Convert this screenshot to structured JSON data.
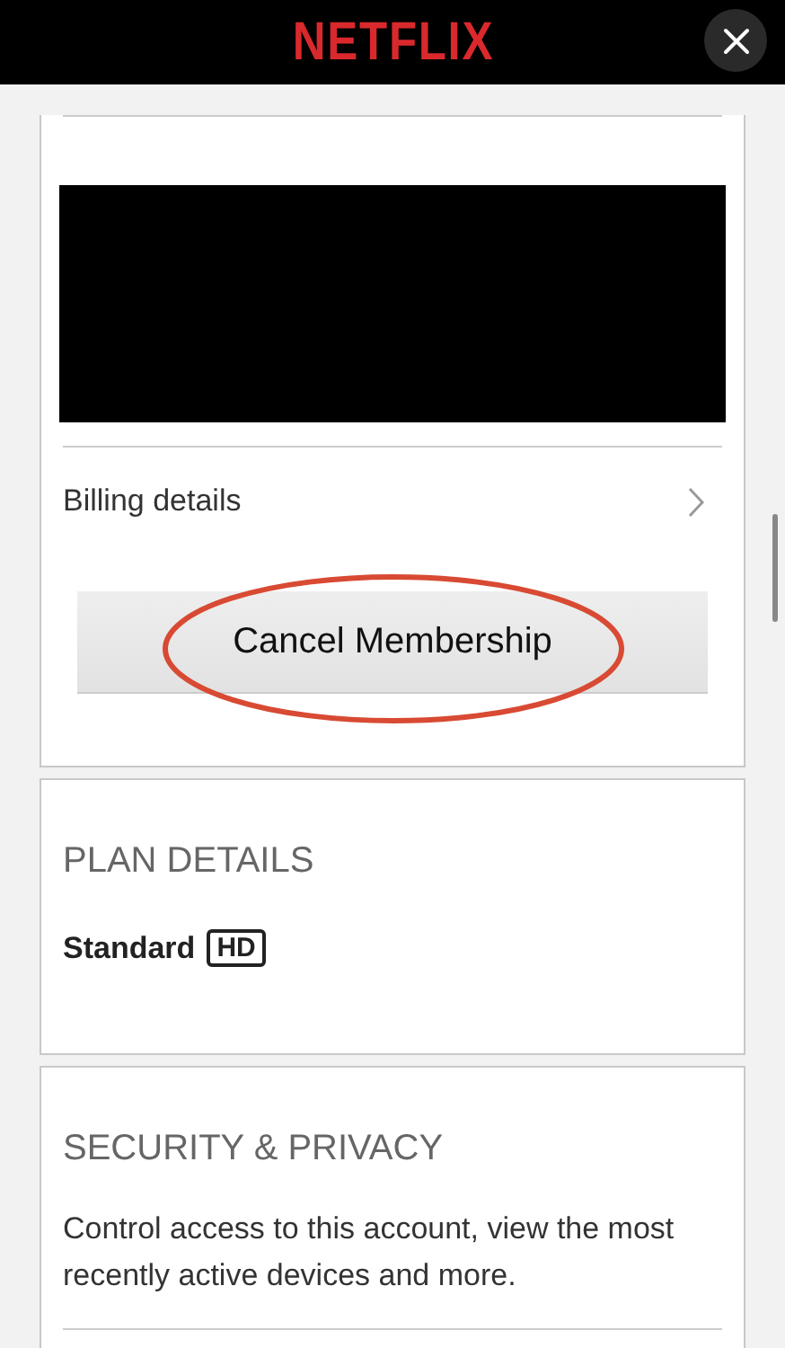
{
  "header": {
    "logo": "NETFLIX"
  },
  "membership_card": {
    "billing_link": "Billing details",
    "cancel_button": "Cancel Membership",
    "annotation_circled": true
  },
  "plan_card": {
    "heading": "PLAN DETAILS",
    "plan": "Standard",
    "quality_badge": "HD"
  },
  "security_card": {
    "heading": "SECURITY & PRIVACY",
    "description": "Control access to this account, view the most recently active devices and more."
  }
}
